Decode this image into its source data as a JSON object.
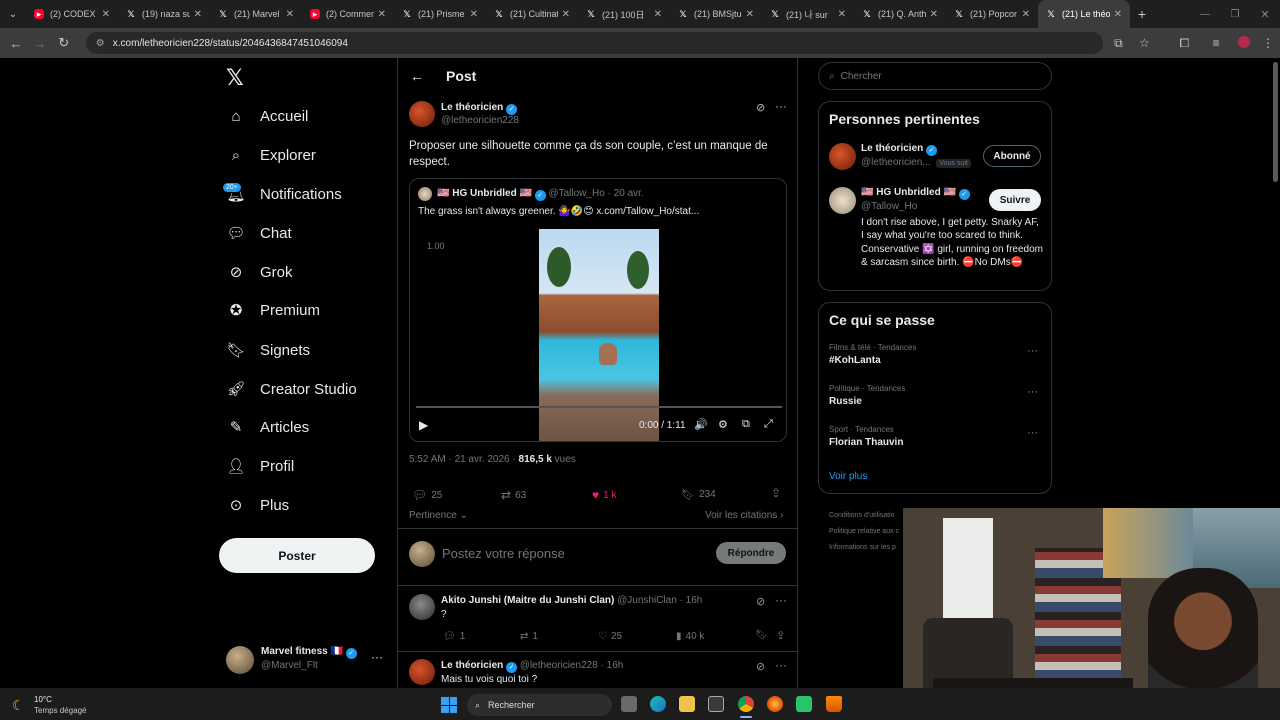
{
  "browser": {
    "tabs": [
      {
        "icon": "youtube",
        "title": "(2) CODEX :"
      },
      {
        "icon": "x",
        "title": "(19) naza su"
      },
      {
        "icon": "x",
        "title": "(21) Marvel"
      },
      {
        "icon": "youtube",
        "title": "(2) Commen"
      },
      {
        "icon": "x",
        "title": "(21) Prisme"
      },
      {
        "icon": "x",
        "title": "(21) Cultinat"
      },
      {
        "icon": "x",
        "title": "(21) 100日"
      },
      {
        "icon": "x",
        "title": "(21) BMSjtu"
      },
      {
        "icon": "x",
        "title": "(21) 나 sur"
      },
      {
        "icon": "x",
        "title": "(21) Q. Anth"
      },
      {
        "icon": "x",
        "title": "(21) Popcor"
      },
      {
        "icon": "x",
        "title": "(21) Le théo",
        "active": true
      }
    ],
    "url": "x.com/letheoricien228/status/2046436847451046094"
  },
  "nav": {
    "items": [
      "Accueil",
      "Explorer",
      "Notifications",
      "Chat",
      "Grok",
      "Premium",
      "Signets",
      "Creator Studio",
      "Articles",
      "Profil",
      "Plus"
    ],
    "notif_badge": "20+",
    "post_button": "Poster",
    "account": {
      "name": "Marvel fitness",
      "flag": "🇫🇷",
      "handle": "@Marvel_Flt"
    }
  },
  "post": {
    "header": "Post",
    "author": {
      "name": "Le théoricien",
      "handle": "@letheoricien228"
    },
    "text": "Proposer une silhouette comme ça ds son couple, c’est un manque de respect.",
    "quote": {
      "name": "🇺🇸 HG Unbridled 🇺🇸",
      "handle": "@Tallow_Ho",
      "date": "20 avr.",
      "text": "The grass isn't always greener. 🤷‍♀️🤣😊 x.com/Tallow_Ho/stat...",
      "speed": "1.00",
      "time": "0:00 / 1:11"
    },
    "timestamp": "5:52 AM · 21 avr. 2026 ·",
    "views_count": "816,5 k",
    "views_label": "vues",
    "stats": {
      "replies": "25",
      "reposts": "63",
      "likes": "1 k",
      "bookmarks": "234"
    },
    "sort": "Pertinence",
    "quotes_link": "Voir les citations",
    "reply_placeholder": "Postez votre réponse",
    "reply_button": "Répondre"
  },
  "replies": [
    {
      "name": "Akito Junshi (Maitre du Junshi Clan)",
      "handle": "@JunshiClan",
      "time": "· 16h",
      "text": "?",
      "replies": "1",
      "reposts": "1",
      "likes": "25",
      "views": "40 k"
    },
    {
      "name": "Le théoricien",
      "handle": "@letheoricien228",
      "time": "· 16h",
      "text": "Mais tu vois quoi toi ?"
    }
  ],
  "right": {
    "search_placeholder": "Chercher",
    "relevant_title": "Personnes pertinentes",
    "people": [
      {
        "name": "Le théoricien",
        "handle": "@letheoricien...",
        "follows_you": "Vous suit",
        "button": "Abonné"
      },
      {
        "name": "🇺🇸 HG Unbridled 🇺🇸",
        "handle": "@Tallow_Ho",
        "button": "Suivre",
        "bio": "I don't rise above, I get petty. Snarky AF, I say what you're too scared to think. Conservative ✡️ girl, running on freedom & sarcasm since birth. ⛔No DMs⛔"
      }
    ],
    "trending_title": "Ce qui se passe",
    "trends": [
      {
        "context": "Films & télé · Tendances",
        "name": "#KohLanta"
      },
      {
        "context": "Politique · Tendances",
        "name": "Russie"
      },
      {
        "context": "Sport · Tendances",
        "name": "Florian Thauvin"
      }
    ],
    "show_more": "Voir plus",
    "footer": [
      "Conditions d'utilisatio",
      "Politique relative aux c",
      "Informations sur les p"
    ]
  },
  "taskbar": {
    "temp": "10°C",
    "weather": "Temps dégagé",
    "search": "Rechercher"
  }
}
